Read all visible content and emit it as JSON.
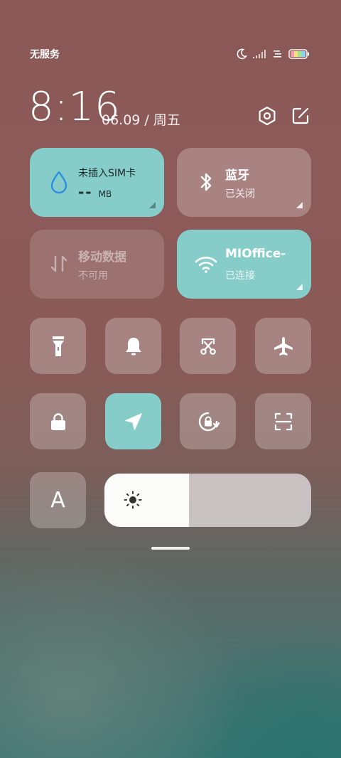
{
  "status_bar": {
    "carrier": "无服务",
    "icons": [
      "moon-icon",
      "signal-icon",
      "data-icon",
      "battery-icon"
    ]
  },
  "header": {
    "time": "8:16",
    "date": "06.09 / 周五",
    "icons": [
      "settings-icon",
      "edit-icon"
    ]
  },
  "tiles": {
    "data_usage": {
      "title": "未插入SIM卡",
      "value": "--",
      "unit": "MB",
      "icon": "water-drop-icon"
    },
    "bluetooth": {
      "title": "蓝牙",
      "status": "已关闭",
      "icon": "bluetooth-icon"
    },
    "mobile_data": {
      "title": "移动数据",
      "status": "不可用",
      "icon": "data-arrows-icon"
    },
    "wifi": {
      "title": "MIOffice-",
      "status": "已连接",
      "icon": "wifi-icon"
    }
  },
  "toggles": [
    {
      "name": "flashlight",
      "icon": "flashlight-icon",
      "active": false
    },
    {
      "name": "ring",
      "icon": "bell-icon",
      "active": false
    },
    {
      "name": "screenshot",
      "icon": "scissors-icon",
      "active": false
    },
    {
      "name": "airplane",
      "icon": "airplane-icon",
      "active": false
    },
    {
      "name": "lock",
      "icon": "lock-icon",
      "active": false
    },
    {
      "name": "location",
      "icon": "location-icon",
      "active": true
    },
    {
      "name": "auto-rotate",
      "icon": "rotate-lock-icon",
      "active": false
    },
    {
      "name": "scan",
      "icon": "scan-icon",
      "active": false
    }
  ],
  "font_button": {
    "label": "A"
  },
  "brightness": {
    "level": 0.41,
    "icon": "sun-icon"
  },
  "colors": {
    "accent": "#86cdca",
    "tile_inactive": "rgba(255,255,255,0.25)",
    "data_drop": "#2a8de0"
  }
}
